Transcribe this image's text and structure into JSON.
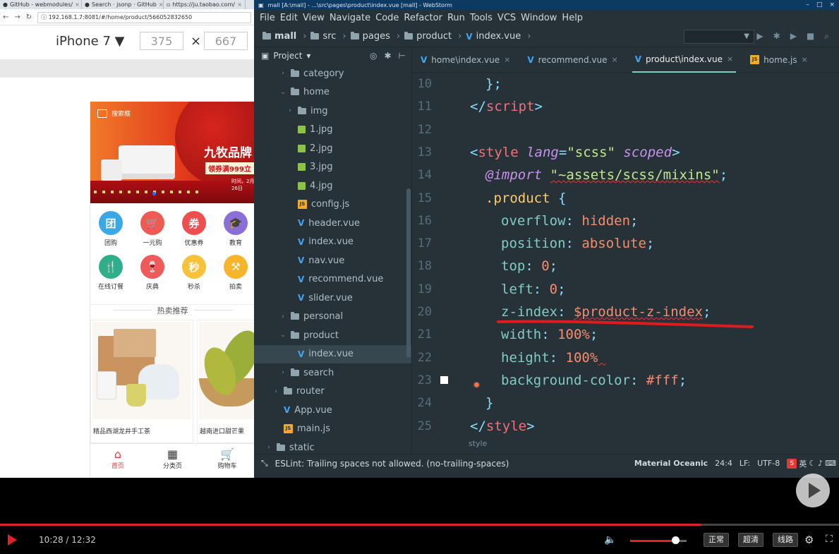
{
  "browser": {
    "tabs": [
      {
        "label": "GitHub - webmodules/"
      },
      {
        "label": "Search · jsonp · GitHub"
      },
      {
        "label": "https://ju.taobao.com/"
      },
      {
        "label": ""
      }
    ],
    "address": "192.168.1.7:8081/#/home/product/566052832650",
    "device": {
      "name": "iPhone 7 ▼",
      "width": "375",
      "height": "667",
      "times": "×"
    }
  },
  "phone": {
    "banner": {
      "search_placeholder": "搜索框",
      "title": "九牧品牌",
      "coupon": "领券满999立",
      "small": "时间，2月26日"
    },
    "grid": [
      {
        "label": "团购",
        "glyph": "团",
        "color": "#3aa7e6"
      },
      {
        "label": "一元购",
        "glyph": "🛒",
        "color": "#ef5a53"
      },
      {
        "label": "优惠券",
        "glyph": "券",
        "color": "#ef4e4e"
      },
      {
        "label": "教育",
        "glyph": "🎓",
        "color": "#8a6fd6"
      },
      {
        "label": "在线订餐",
        "glyph": "🍴",
        "color": "#2fae8c"
      },
      {
        "label": "庆典",
        "glyph": "🍷",
        "color": "#ef5a5a"
      },
      {
        "label": "秒杀",
        "glyph": "秒",
        "color": "#f6c23a"
      },
      {
        "label": "拍卖",
        "glyph": "⚒",
        "color": "#f6b52a"
      }
    ],
    "hot_title": "热卖推荐",
    "products": [
      {
        "name": "精品西湖龙井手工茶"
      },
      {
        "name": "越南进口甜芒果"
      }
    ],
    "tabbar": [
      {
        "label": "首页",
        "glyph": "⌂"
      },
      {
        "label": "分类页",
        "glyph": "▦"
      },
      {
        "label": "购物车",
        "glyph": "🛒"
      }
    ]
  },
  "ide": {
    "window_title": "mall [A:\\mall] - ...\\src\\pages\\product\\index.vue [mall] - WebStorm",
    "menu": [
      "File",
      "Edit",
      "View",
      "Navigate",
      "Code",
      "Refactor",
      "Run",
      "Tools",
      "VCS",
      "Window",
      "Help"
    ],
    "breadcrumb": [
      "mall",
      "src",
      "pages",
      "product",
      "index.vue"
    ],
    "project_label": "Project",
    "tree": [
      {
        "label": "category",
        "type": "folder",
        "indent": 1,
        "arrow": "›"
      },
      {
        "label": "home",
        "type": "folder",
        "indent": 1,
        "arrow": "⌄"
      },
      {
        "label": "img",
        "type": "folder",
        "indent": 2,
        "arrow": "›"
      },
      {
        "label": "1.jpg",
        "type": "img",
        "indent": 2,
        "arrow": ""
      },
      {
        "label": "2.jpg",
        "type": "img",
        "indent": 2,
        "arrow": ""
      },
      {
        "label": "3.jpg",
        "type": "img",
        "indent": 2,
        "arrow": ""
      },
      {
        "label": "4.jpg",
        "type": "img",
        "indent": 2,
        "arrow": ""
      },
      {
        "label": "config.js",
        "type": "js",
        "indent": 2,
        "arrow": ""
      },
      {
        "label": "header.vue",
        "type": "vue",
        "indent": 2,
        "arrow": ""
      },
      {
        "label": "index.vue",
        "type": "vue",
        "indent": 2,
        "arrow": ""
      },
      {
        "label": "nav.vue",
        "type": "vue",
        "indent": 2,
        "arrow": ""
      },
      {
        "label": "recommend.vue",
        "type": "vue",
        "indent": 2,
        "arrow": ""
      },
      {
        "label": "slider.vue",
        "type": "vue",
        "indent": 2,
        "arrow": ""
      },
      {
        "label": "personal",
        "type": "folder",
        "indent": 1,
        "arrow": "›"
      },
      {
        "label": "product",
        "type": "folder",
        "indent": 1,
        "arrow": "⌄"
      },
      {
        "label": "index.vue",
        "type": "vue",
        "indent": 2,
        "arrow": "",
        "selected": true
      },
      {
        "label": "search",
        "type": "folder",
        "indent": 1,
        "arrow": "›"
      },
      {
        "label": "router",
        "type": "folder",
        "indent": 0,
        "arrow": "›"
      },
      {
        "label": "App.vue",
        "type": "vue",
        "indent": 0,
        "arrow": ""
      },
      {
        "label": "main.js",
        "type": "js",
        "indent": 0,
        "arrow": ""
      },
      {
        "label": "static",
        "type": "folder",
        "indent": -1,
        "arrow": "›"
      }
    ],
    "editor_tabs": [
      {
        "label": "home\\index.vue",
        "type": "vue"
      },
      {
        "label": "recommend.vue",
        "type": "vue"
      },
      {
        "label": "product\\index.vue",
        "type": "vue",
        "active": true
      },
      {
        "label": "home.js",
        "type": "js"
      }
    ],
    "code": [
      {
        "n": "10",
        "indent": 1,
        "parts": [
          [
            "c-punc",
            "};"
          ]
        ]
      },
      {
        "n": "11",
        "indent": 0,
        "parts": [
          [
            "c-punc",
            "</"
          ],
          [
            "c-tag",
            "script"
          ],
          [
            "c-punc",
            ">"
          ]
        ]
      },
      {
        "n": "12",
        "indent": 0,
        "parts": []
      },
      {
        "n": "13",
        "indent": 0,
        "parts": [
          [
            "c-punc",
            "<"
          ],
          [
            "c-tag",
            "style"
          ],
          [
            "c-plain",
            " "
          ],
          [
            "c-attr",
            "lang"
          ],
          [
            "c-punc",
            "="
          ],
          [
            "c-str",
            "\"scss\""
          ],
          [
            "c-plain",
            " "
          ],
          [
            "c-attr",
            "scoped"
          ],
          [
            "c-punc",
            ">"
          ]
        ]
      },
      {
        "n": "14",
        "indent": 1,
        "parts": [
          [
            "c-kw",
            "@import"
          ],
          [
            "c-plain",
            " "
          ],
          [
            "c-str squig",
            "\"~assets/scss/mixins\""
          ],
          [
            "c-punc",
            ";"
          ]
        ]
      },
      {
        "n": "15",
        "indent": 1,
        "parts": [
          [
            "c-sel",
            ".product"
          ],
          [
            "c-plain",
            " "
          ],
          [
            "c-punc",
            "{"
          ]
        ]
      },
      {
        "n": "16",
        "indent": 2,
        "parts": [
          [
            "c-prop",
            "overflow"
          ],
          [
            "c-punc",
            ": "
          ],
          [
            "c-val",
            "hidden"
          ],
          [
            "c-punc",
            ";"
          ]
        ]
      },
      {
        "n": "17",
        "indent": 2,
        "parts": [
          [
            "c-prop",
            "position"
          ],
          [
            "c-punc",
            ": "
          ],
          [
            "c-val",
            "absolute"
          ],
          [
            "c-punc",
            ";"
          ]
        ]
      },
      {
        "n": "18",
        "indent": 2,
        "parts": [
          [
            "c-prop",
            "top"
          ],
          [
            "c-punc",
            ": "
          ],
          [
            "c-val",
            "0"
          ],
          [
            "c-punc",
            ";"
          ]
        ]
      },
      {
        "n": "19",
        "indent": 2,
        "parts": [
          [
            "c-prop",
            "left"
          ],
          [
            "c-punc",
            ": "
          ],
          [
            "c-val",
            "0"
          ],
          [
            "c-punc",
            ";"
          ]
        ]
      },
      {
        "n": "20",
        "indent": 2,
        "parts": [
          [
            "c-prop",
            "z-index"
          ],
          [
            "c-punc",
            ": "
          ],
          [
            "c-var squig",
            "$product-z-index"
          ],
          [
            "c-punc",
            ";"
          ]
        ]
      },
      {
        "n": "21",
        "indent": 2,
        "parts": [
          [
            "c-prop",
            "width"
          ],
          [
            "c-punc",
            ": "
          ],
          [
            "c-val",
            "100%"
          ],
          [
            "c-punc",
            ";"
          ]
        ]
      },
      {
        "n": "22",
        "indent": 2,
        "parts": [
          [
            "c-prop",
            "height"
          ],
          [
            "c-punc",
            ": "
          ],
          [
            "c-val",
            "100%"
          ],
          [
            "c-punc squig",
            " "
          ]
        ]
      },
      {
        "n": "23",
        "indent": 2,
        "parts": [
          [
            "c-prop",
            "background-color"
          ],
          [
            "c-punc",
            ": "
          ],
          [
            "c-val",
            "#fff"
          ],
          [
            "c-punc",
            ";"
          ]
        ]
      },
      {
        "n": "24",
        "indent": 1,
        "parts": [
          [
            "c-punc",
            "}"
          ]
        ]
      },
      {
        "n": "25",
        "indent": 0,
        "parts": [
          [
            "c-punc",
            "</"
          ],
          [
            "c-tag",
            "style"
          ],
          [
            "c-punc",
            ">"
          ]
        ]
      }
    ],
    "bottom_crumb": "style",
    "status": {
      "message": "ESLint: Trailing spaces not allowed. (no-trailing-spaces)",
      "theme": "Material Oceanic",
      "position": "24:4",
      "line_sep": "LF:",
      "encoding": "UTF-8",
      "ime": "英"
    }
  },
  "player": {
    "time": "10:28 / 12:32",
    "progress": 0.835,
    "volume": 0.8,
    "quality_buttons": [
      "正常",
      "超清",
      "线路"
    ]
  },
  "colors": {
    "accent": "#e0202a",
    "ide_bg": "#263238"
  }
}
